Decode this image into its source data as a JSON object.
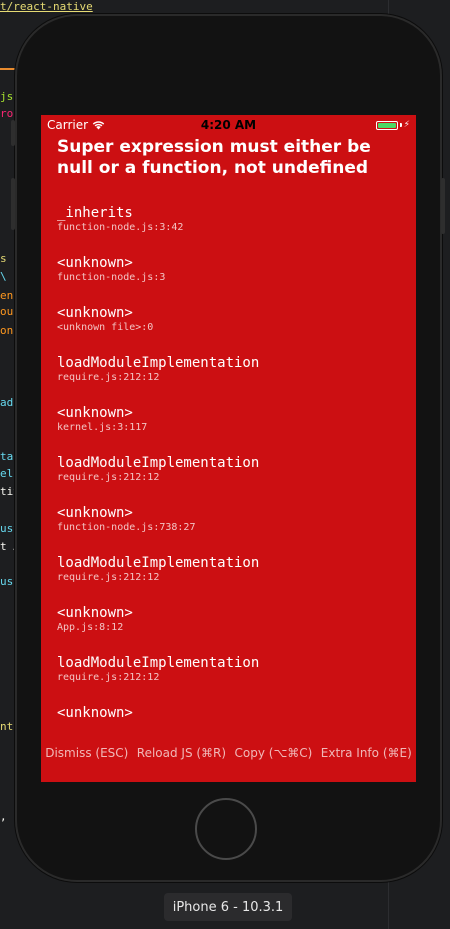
{
  "editor": {
    "path_text": "t/react-native",
    "gutter_fragments": [
      "js",
      "ro",
      "s",
      "\\",
      "en",
      "our",
      "on",
      "ads",
      "tai",
      "elo",
      "tiv",
      "ust",
      "t A",
      "ust",
      "nte",
      ","
    ]
  },
  "status_bar": {
    "carrier": "Carrier",
    "time": "4:20 AM"
  },
  "redbox": {
    "title": "Super expression must either be null or a function, not undefined",
    "frames": [
      {
        "method": "_inherits",
        "file": "function-node.js:3:42"
      },
      {
        "method": "<unknown>",
        "file": "function-node.js:3"
      },
      {
        "method": "<unknown>",
        "file": "<unknown file>:0"
      },
      {
        "method": "loadModuleImplementation",
        "file": "require.js:212:12"
      },
      {
        "method": "<unknown>",
        "file": "kernel.js:3:117"
      },
      {
        "method": "loadModuleImplementation",
        "file": "require.js:212:12"
      },
      {
        "method": "<unknown>",
        "file": "function-node.js:738:27"
      },
      {
        "method": "loadModuleImplementation",
        "file": "require.js:212:12"
      },
      {
        "method": "<unknown>",
        "file": "App.js:8:12"
      },
      {
        "method": "loadModuleImplementation",
        "file": "require.js:212:12"
      },
      {
        "method": "<unknown>",
        "file": ""
      }
    ],
    "buttons": {
      "dismiss": "Dismiss (ESC)",
      "reload": "Reload JS (⌘R)",
      "copy": "Copy (⌥⌘C)",
      "extra": "Extra Info (⌘E)"
    }
  },
  "device": {
    "label": "iPhone 6 - 10.3.1"
  },
  "colors": {
    "redbox_background": "#cc0f12",
    "battery": "#4cd964"
  }
}
